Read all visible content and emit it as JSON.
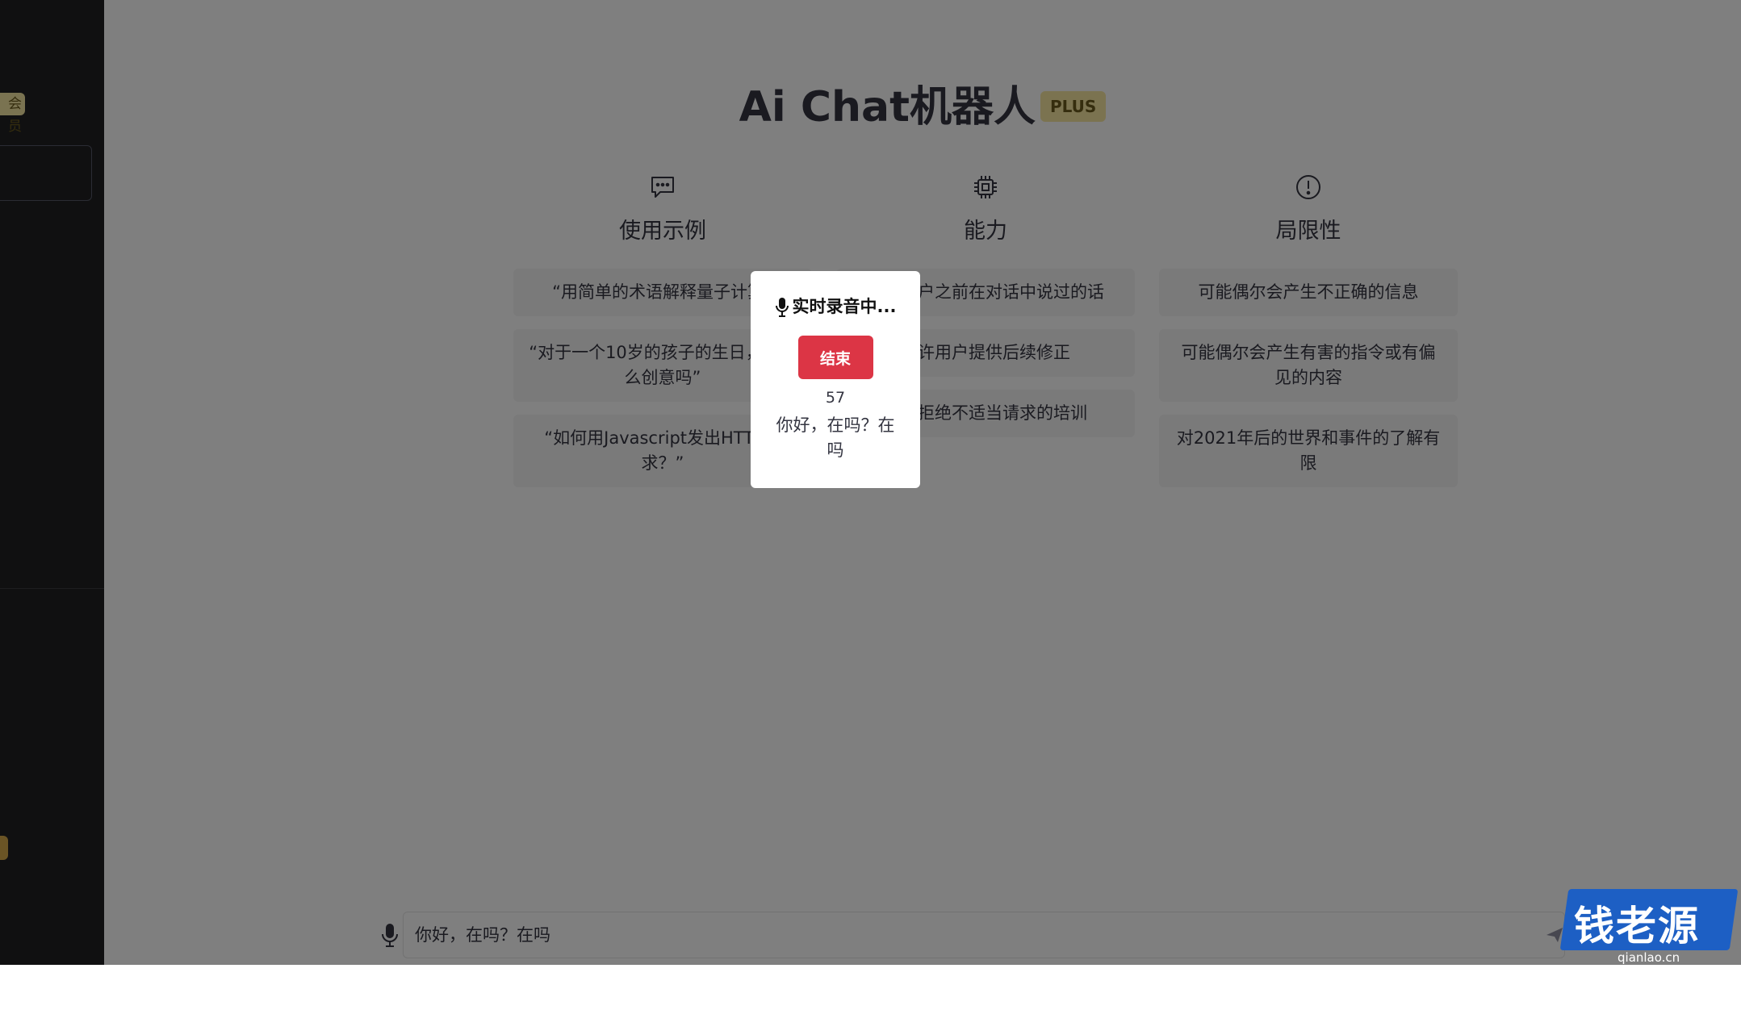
{
  "sidebar": {
    "vip_tag": "会员"
  },
  "main": {
    "title": "Ai Chat机器人",
    "plus_badge": "PLUS",
    "columns": [
      {
        "icon": "chat-bubble-icon",
        "title": "使用示例",
        "cards": [
          "“用简单的术语解释量子计算”",
          "“对于一个10岁的孩子的生日，有什么创意吗”",
          "“如何用Javascript发出HTTP请求？”"
        ]
      },
      {
        "icon": "chip-icon",
        "title": "能力",
        "cards": [
          "记住用户之前在对话中说过的话",
          "允许用户提供后续修正",
          "经过拒绝不适当请求的培训"
        ]
      },
      {
        "icon": "warning-circle-icon",
        "title": "局限性",
        "cards": [
          "可能偶尔会产生不正确的信息",
          "可能偶尔会产生有害的指令或有偏见的内容",
          "对2021年后的世界和事件的了解有限"
        ]
      }
    ]
  },
  "input": {
    "value": "你好，在吗？在吗"
  },
  "modal": {
    "title": "实时录音中...",
    "end_button": "结束",
    "count": "57",
    "transcript": "你好，在吗？在吗"
  },
  "watermark": {
    "text": "钱老源码",
    "sub": "qianlao.cn"
  },
  "colors": {
    "sidebar_bg": "#202123",
    "end_button": "#dc3545",
    "plus_badge": "#f7e7a1",
    "watermark": "#1d5fc4"
  }
}
